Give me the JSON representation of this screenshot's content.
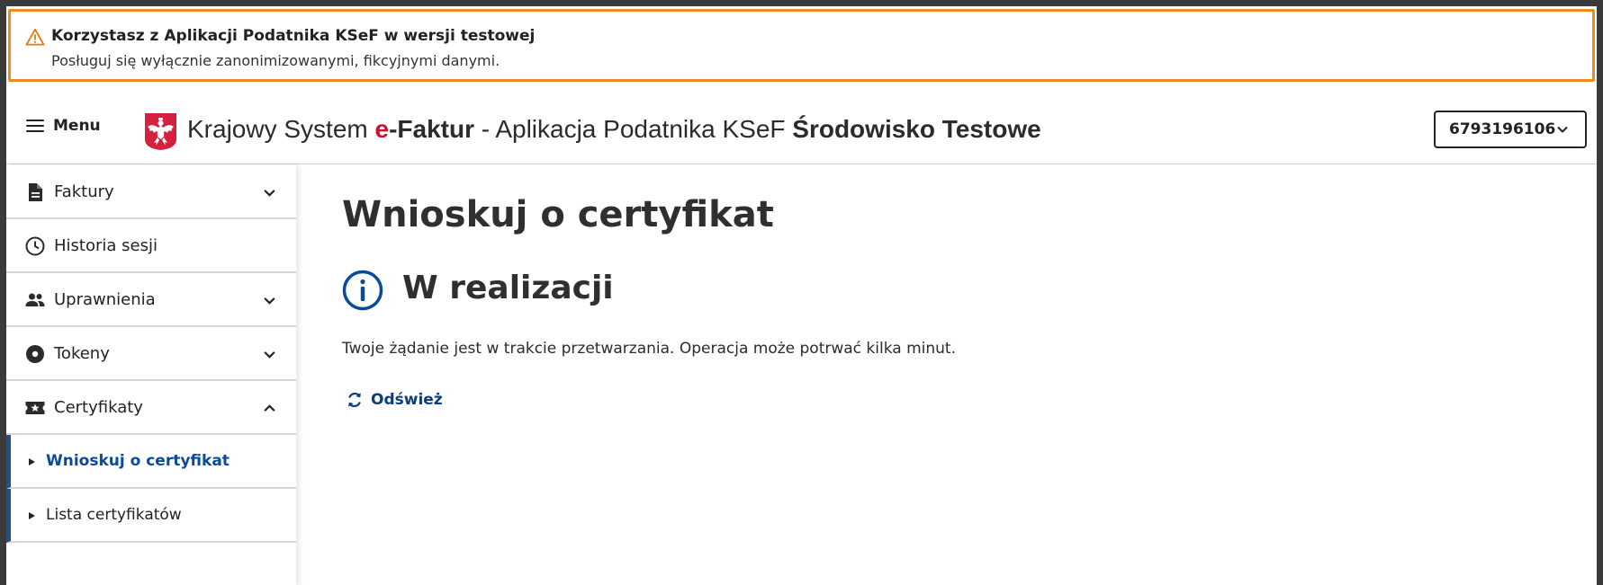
{
  "banner": {
    "title": "Korzystasz z Aplikacji Podatnika KSeF w wersji testowej",
    "text": "Posługuj się wyłącznie zanonimizowanymi, fikcyjnymi danymi.",
    "icon": "warning-icon",
    "border_color": "#f08a1e"
  },
  "header": {
    "menu_label": "Menu",
    "title_prefix": "Krajowy System ",
    "title_brand_e": "e",
    "title_brand_rest": "-Faktur",
    "title_middle": " - Aplikacja Podatnika KSeF ",
    "title_env": "Środowisko Testowe",
    "nip_value": "6793196106",
    "brand_color": "#cc1133"
  },
  "sidebar": {
    "items": [
      {
        "label": "Faktury",
        "icon": "document-icon",
        "expandable": true,
        "expanded": false
      },
      {
        "label": "Historia sesji",
        "icon": "clock-icon",
        "expandable": false
      },
      {
        "label": "Uprawnienia",
        "icon": "people-icon",
        "expandable": true,
        "expanded": false
      },
      {
        "label": "Tokeny",
        "icon": "token-icon",
        "expandable": true,
        "expanded": false
      },
      {
        "label": "Certyfikaty",
        "icon": "certificate-icon",
        "expandable": true,
        "expanded": true
      }
    ],
    "sub_items": [
      {
        "label": "Wnioskuj o certyfikat",
        "active": true
      },
      {
        "label": "Lista certyfikatów",
        "active": false
      }
    ],
    "accent_color": "#1f4f8f"
  },
  "main": {
    "page_title": "Wnioskuj o certyfikat",
    "status_title": "W realizacji",
    "status_text": "Twoje żądanie jest w trakcie przetwarzania. Operacja może potrwać kilka minut.",
    "refresh_label": "Odśwież",
    "status_icon": "info-icon",
    "accent_color": "#0a4a9c"
  }
}
